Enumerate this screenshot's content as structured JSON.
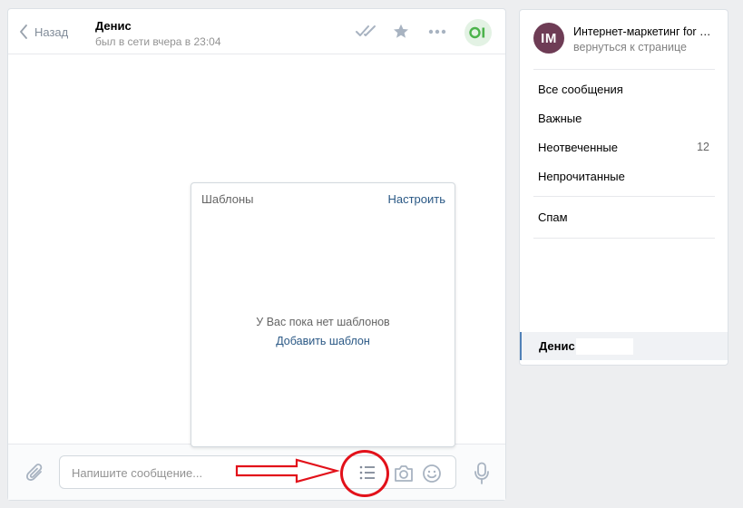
{
  "header": {
    "back_label": "Назад",
    "peer_name": "Денис",
    "peer_status": "был в сети вчера в 23:04",
    "icons": [
      "check-double-icon",
      "star-icon",
      "more-icon"
    ],
    "avatar_icon_color": "#4bb34b"
  },
  "templates": {
    "title": "Шаблоны",
    "setup_label": "Настроить",
    "empty_text": "У Вас пока нет шаблонов",
    "add_label": "Добавить шаблон"
  },
  "composer": {
    "placeholder": "Напишите сообщение...",
    "value": "",
    "icons": [
      "paperclip-icon",
      "template-list-icon",
      "camera-icon",
      "smile-icon",
      "microphone-icon"
    ],
    "highlight_color": "#e2111a"
  },
  "sidebar": {
    "community_initials": "IM",
    "community_name": "Интернет-маркетинг for …",
    "community_back": "вернуться к странице",
    "items": [
      {
        "label": "Все сообщения",
        "count": ""
      },
      {
        "label": "Важные",
        "count": ""
      },
      {
        "label": "Неотвеченные",
        "count": "12"
      },
      {
        "label": "Непрочитанные",
        "count": ""
      },
      {
        "label": "Спам",
        "count": ""
      }
    ],
    "active_dialog": "Денис"
  },
  "colors": {
    "background": "#edeef0",
    "link": "#2a5885",
    "accent": "#5181b8",
    "community_avatar": "#6e3c55"
  }
}
